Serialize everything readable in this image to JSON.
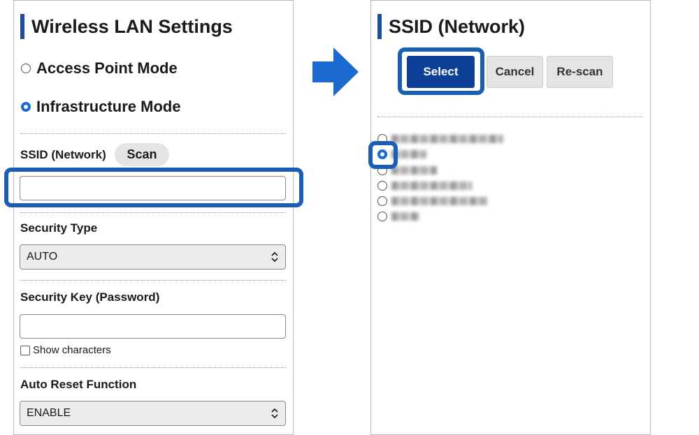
{
  "left_panel": {
    "title": "Wireless LAN Settings",
    "mode_options": [
      {
        "label": "Access Point Mode",
        "selected": false
      },
      {
        "label": "Infrastructure Mode",
        "selected": true
      }
    ],
    "ssid_label": "SSID (Network)",
    "scan_label": "Scan",
    "ssid_value": "",
    "security_type_label": "Security Type",
    "security_type_value": "AUTO",
    "security_key_label": "Security Key (Password)",
    "security_key_value": "",
    "show_characters_label": "Show characters",
    "show_characters_checked": false,
    "auto_reset_label": "Auto Reset Function",
    "auto_reset_value": "ENABLE"
  },
  "right_panel": {
    "title": "SSID (Network)",
    "select_label": "Select",
    "cancel_label": "Cancel",
    "rescan_label": "Re-scan",
    "networks_selected_index": 1
  },
  "colors": {
    "accent": "#1a5fb4",
    "primary_button": "#0e3f96",
    "heading_bar": "#1f4e9c"
  }
}
